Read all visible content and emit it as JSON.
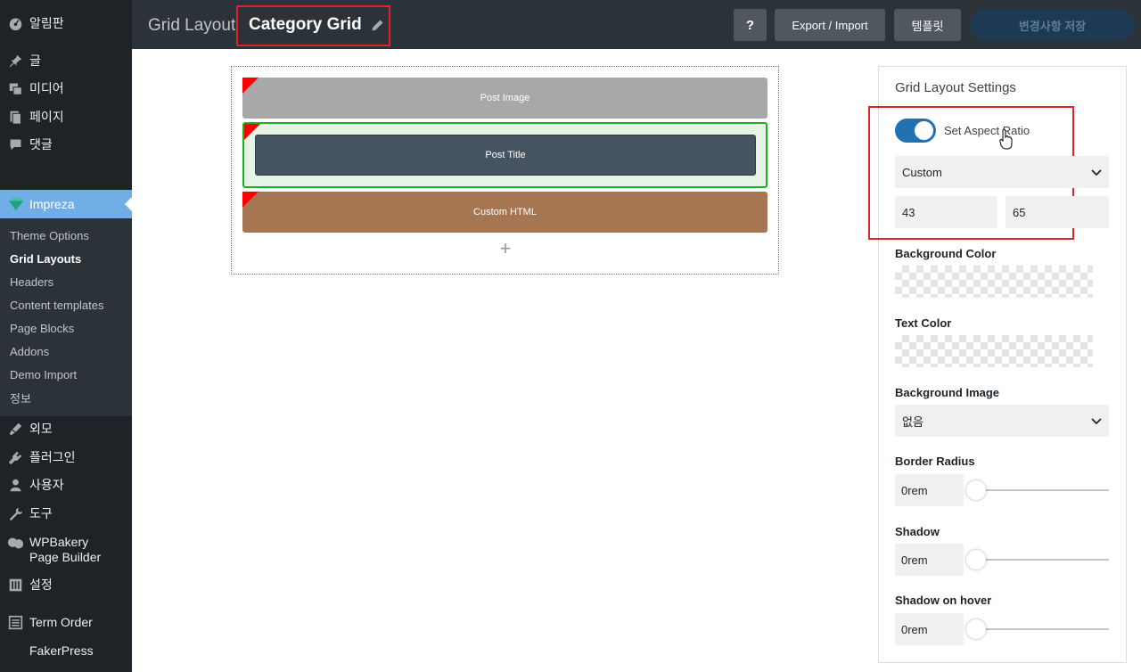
{
  "sidebar": {
    "items": [
      {
        "label": "알림판",
        "icon": "dashboard-icon"
      },
      {
        "label": "글",
        "icon": "pin-icon"
      },
      {
        "label": "미디어",
        "icon": "media-icon"
      },
      {
        "label": "페이지",
        "icon": "pages-icon"
      },
      {
        "label": "댓글",
        "icon": "comments-icon"
      },
      {
        "label": "Impreza",
        "icon": "impreza-icon"
      },
      {
        "label": "외모",
        "icon": "appearance-icon"
      },
      {
        "label": "플러그인",
        "icon": "plugins-icon"
      },
      {
        "label": "사용자",
        "icon": "users-icon"
      },
      {
        "label": "도구",
        "icon": "tools-icon"
      },
      {
        "label": "WPBakery Page Builder",
        "icon": "wpbakery-icon"
      },
      {
        "label": "설정",
        "icon": "settings-icon"
      },
      {
        "label": "Term Order",
        "icon": "list-icon"
      },
      {
        "label": "FakerPress",
        "icon": ""
      }
    ],
    "submenu": [
      "Theme Options",
      "Grid Layouts",
      "Headers",
      "Content templates",
      "Page Blocks",
      "Addons",
      "Demo Import",
      "정보"
    ],
    "submenu_current": "Grid Layouts"
  },
  "topbar": {
    "breadcrumb": "Grid Layout",
    "title": "Category Grid",
    "help_label": "?",
    "export_label": "Export / Import",
    "template_label": "템플릿",
    "save_label": "변경사항 저장"
  },
  "builder": {
    "elements": [
      "Post Image",
      "Post Title",
      "Custom HTML"
    ],
    "add_label": "+"
  },
  "panel": {
    "title": "Grid Layout Settings",
    "aspect_label": "Set Aspect Ratio",
    "aspect_enabled": true,
    "aspect_select": "Custom",
    "aspect_width": "43",
    "aspect_height": "65",
    "bg_color_label": "Background Color",
    "text_color_label": "Text Color",
    "bg_image_label": "Background Image",
    "bg_image_select": "없음",
    "border_radius_label": "Border Radius",
    "border_radius_value": "0rem",
    "shadow_label": "Shadow",
    "shadow_value": "0rem",
    "shadow_hover_label": "Shadow on hover",
    "shadow_hover_value": "0rem"
  },
  "colors": {
    "sidebar_bg": "#1d2327",
    "accent": "#72aee6",
    "highlight": "#e2222b",
    "toggle_on": "#2271b1",
    "image_el": "#a8a8a8",
    "title_el": "#465462",
    "html_el": "#a67552"
  }
}
